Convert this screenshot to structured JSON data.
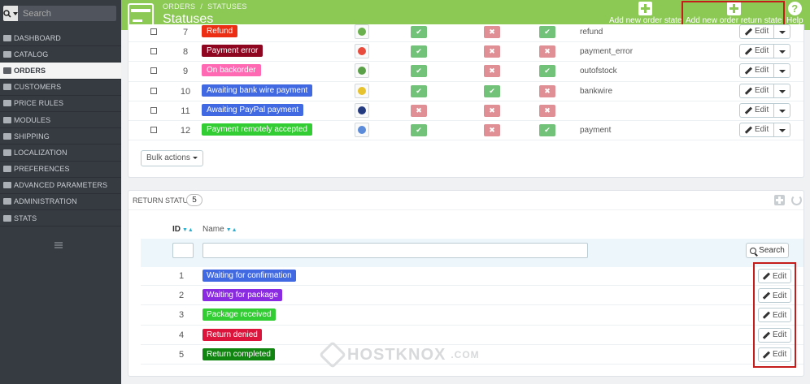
{
  "search": {
    "placeholder": "Search"
  },
  "sidebar": {
    "items": [
      {
        "label": "DASHBOARD",
        "icon": "dashboard-icon"
      },
      {
        "label": "CATALOG",
        "icon": "catalog-icon"
      },
      {
        "label": "ORDERS",
        "icon": "orders-icon",
        "active": true
      },
      {
        "label": "CUSTOMERS",
        "icon": "customers-icon"
      },
      {
        "label": "PRICE RULES",
        "icon": "price-rules-icon"
      },
      {
        "label": "MODULES",
        "icon": "modules-icon"
      },
      {
        "label": "SHIPPING",
        "icon": "shipping-icon"
      },
      {
        "label": "LOCALIZATION",
        "icon": "globe-icon"
      },
      {
        "label": "PREFERENCES",
        "icon": "wrench-icon"
      },
      {
        "label": "ADVANCED PARAMETERS",
        "icon": "cogs-icon"
      },
      {
        "label": "ADMINISTRATION",
        "icon": "cog-icon"
      },
      {
        "label": "STATS",
        "icon": "stats-icon"
      }
    ]
  },
  "header": {
    "breadcrumb": [
      "ORDERS",
      "STATUSES"
    ],
    "breadcrumb_sep": "/",
    "title": "Statuses",
    "add_order_state": "Add new order state",
    "add_return_state": "Add new order return state",
    "help": "Help"
  },
  "order_states": {
    "edit_label": "Edit",
    "bulk_label": "Bulk actions",
    "rows": [
      {
        "id": "7",
        "name": "Refund",
        "color": "#ec2e15",
        "icon_color": "#6ab04c",
        "flags": [
          "yes",
          "no",
          "yes"
        ],
        "template": "refund"
      },
      {
        "id": "8",
        "name": "Payment error",
        "color": "#8f0621",
        "icon_color": "#e74c3c",
        "flags": [
          "yes",
          "no",
          "no"
        ],
        "template": "payment_error"
      },
      {
        "id": "9",
        "name": "On backorder",
        "color": "#ff69b4",
        "icon_color": "#5aa048",
        "flags": [
          "yes",
          "no",
          "yes"
        ],
        "template": "outofstock"
      },
      {
        "id": "10",
        "name": "Awaiting bank wire payment",
        "color": "#4169e1",
        "icon_color": "#e6c22e",
        "flags": [
          "yes",
          "yes",
          "no"
        ],
        "template": "bankwire"
      },
      {
        "id": "11",
        "name": "Awaiting PayPal payment",
        "color": "#4169e1",
        "icon_color": "#253b80",
        "flags": [
          "no",
          "no",
          "no"
        ],
        "template": ""
      },
      {
        "id": "12",
        "name": "Payment remotely accepted",
        "color": "#32cd32",
        "icon_color": "#5b8bd9",
        "flags": [
          "yes",
          "no",
          "yes"
        ],
        "template": "payment"
      }
    ]
  },
  "return_status": {
    "title": "RETURN STATUS",
    "count": "5",
    "col_id": "ID",
    "col_name": "Name",
    "search_label": "Search",
    "edit_label": "Edit",
    "rows": [
      {
        "id": "1",
        "name": "Waiting for confirmation",
        "color": "#4169e1"
      },
      {
        "id": "2",
        "name": "Waiting for package",
        "color": "#8a2be2"
      },
      {
        "id": "3",
        "name": "Package received",
        "color": "#32cd32"
      },
      {
        "id": "4",
        "name": "Return denied",
        "color": "#dc143c"
      },
      {
        "id": "5",
        "name": "Return completed",
        "color": "#108510"
      }
    ]
  },
  "watermark": {
    "text": "HOSTKNOX",
    "domain": ".COM"
  }
}
